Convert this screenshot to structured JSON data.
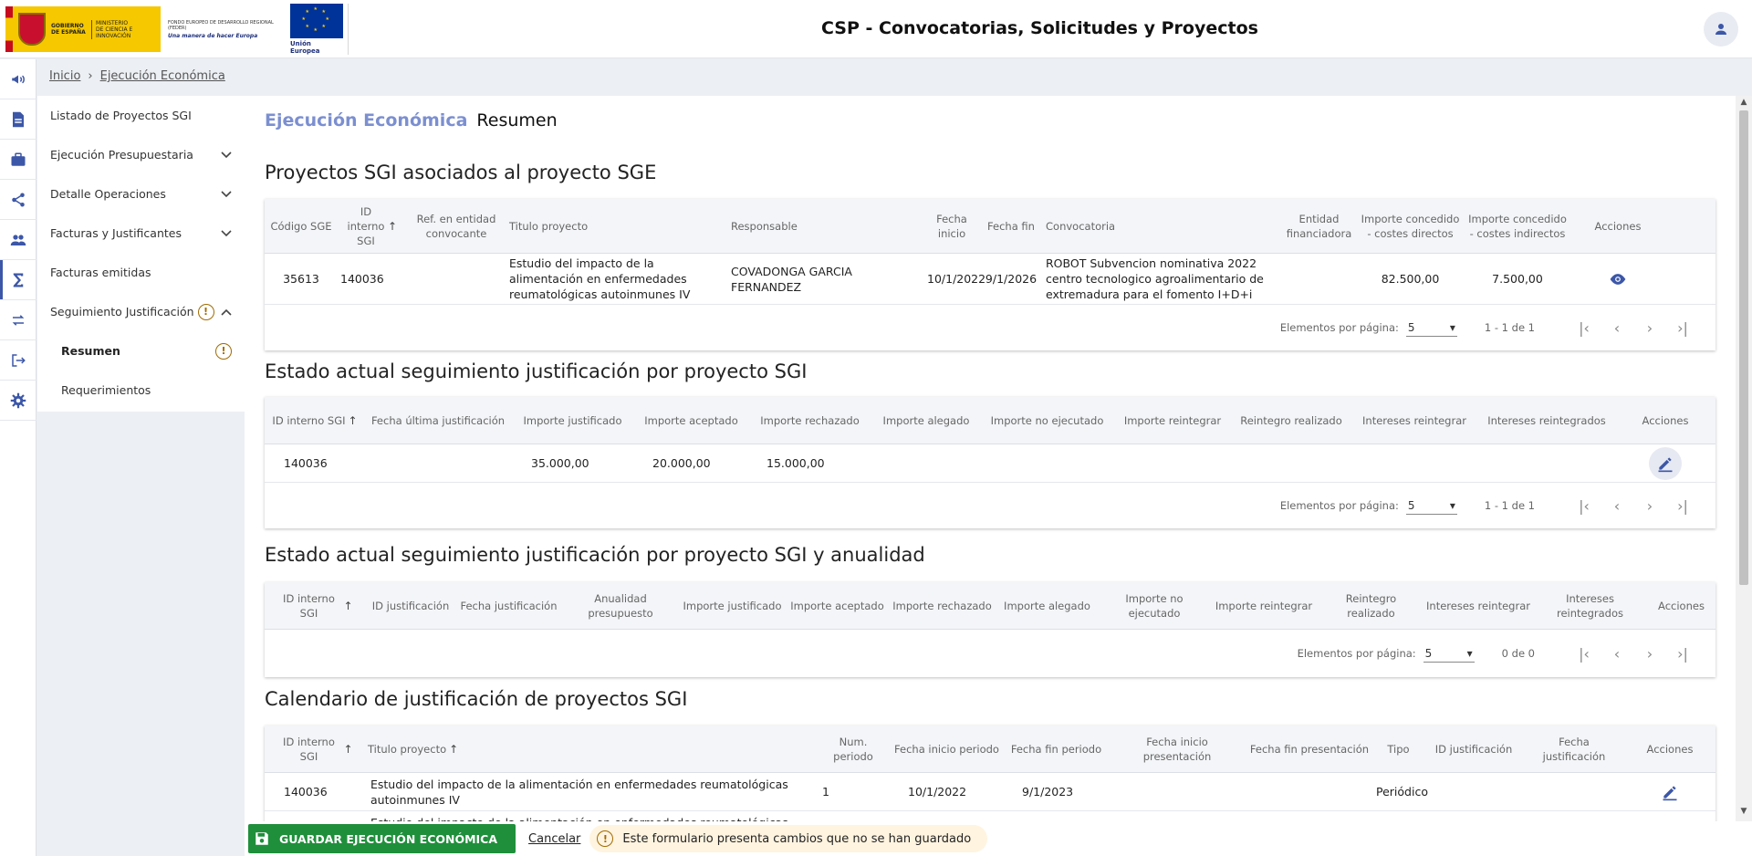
{
  "header": {
    "gov_text": "GOBIERNO DE ESPAÑA",
    "ministry_text": "MINISTERIO DE CIENCIA E INNOVACIÓN",
    "feder_text": "FONDO EUROPEO DE DESARROLLO REGIONAL (FEDER)",
    "feder_slogan": "Una manera de hacer Europa",
    "eu_text": "Unión Europea",
    "title": "CSP - Convocatorias, Solicitudes y Proyectos"
  },
  "rail": [
    "megaphone-icon",
    "document-icon",
    "briefcase-icon",
    "share-icon",
    "people-icon",
    "sigma-icon",
    "swap-icon",
    "logout-icon",
    "settings-icon"
  ],
  "breadcrumb": {
    "home": "Inicio",
    "current": "Ejecución Económica"
  },
  "menu": {
    "listado": "Listado de Proyectos SGI",
    "ejecucion_presupuestaria": "Ejecución Presupuestaria",
    "detalle_operaciones": "Detalle Operaciones",
    "facturas_justificantes": "Facturas y Justificantes",
    "facturas_emitidas": "Facturas emitidas",
    "seguimiento": "Seguimiento Justificación",
    "resumen": "Resumen",
    "requerimientos": "Requerimientos",
    "warn_glyph": "!"
  },
  "page": {
    "title": "Ejecución Económica",
    "subtitle": "Resumen"
  },
  "section1": {
    "title": "Proyectos SGI asociados al proyecto SGE",
    "headers": {
      "codigo": "Código SGE",
      "id_interno": "ID interno SGI",
      "ref": "Ref. en entidad convocante",
      "titulo": "Titulo proyecto",
      "responsable": "Responsable",
      "fecha_inicio": "Fecha inicio",
      "fecha_fin": "Fecha fin",
      "convocatoria": "Convocatoria",
      "entidad": "Entidad financiadora",
      "imp_directos": "Importe concedido - costes directos",
      "imp_indirectos": "Importe concedido - costes indirectos",
      "acciones": "Acciones"
    },
    "row": {
      "codigo": "35613",
      "id_interno": "140036",
      "titulo": "Estudio del impacto de la alimentación en enfermedades reumatológicas autoinmunes IV",
      "responsable": "COVADONGA GARCIA FERNANDEZ",
      "fecha_inicio": "10/1/2022",
      "fecha_fin": "9/1/2026",
      "convocatoria": "ROBOT Subvencion nominativa 2022 centro tecnologico agroalimentario de extremadura para el fomento I+D+i",
      "imp_directos": "82.500,00",
      "imp_indirectos": "7.500,00"
    },
    "paginator": {
      "label": "Elementos por página:",
      "size": "5",
      "range": "1 - 1 de 1"
    }
  },
  "section2": {
    "title": "Estado actual seguimiento justificación por proyecto SGI",
    "headers": {
      "id_interno": "ID interno SGI",
      "fecha_ultima": "Fecha última justificación",
      "imp_justificado": "Importe justificado",
      "imp_aceptado": "Importe aceptado",
      "imp_rechazado": "Importe rechazado",
      "imp_alegado": "Importe alegado",
      "imp_no_ejecutado": "Importe no ejecutado",
      "imp_reintegrar": "Importe reintegrar",
      "reintegro_realizado": "Reintegro realizado",
      "intereses_reintegrar": "Intereses reintegrar",
      "intereses_reintegrados": "Intereses reintegrados",
      "acciones": "Acciones"
    },
    "row": {
      "id_interno": "140036",
      "imp_justificado": "35.000,00",
      "imp_aceptado": "20.000,00",
      "imp_rechazado": "15.000,00"
    },
    "paginator": {
      "label": "Elementos por página:",
      "size": "5",
      "range": "1 - 1 de 1"
    }
  },
  "section3": {
    "title": "Estado actual seguimiento justificación por proyecto SGI y anualidad",
    "headers": {
      "id_interno": "ID interno SGI",
      "id_justificacion": "ID justificación",
      "fecha_justificacion": "Fecha justificación",
      "anualidad": "Anualidad presupuesto",
      "imp_justificado": "Importe justificado",
      "imp_aceptado": "Importe aceptado",
      "imp_rechazado": "Importe rechazado",
      "imp_alegado": "Importe alegado",
      "imp_no_ejecutado": "Importe no ejecutado",
      "imp_reintegrar": "Importe reintegrar",
      "reintegro_realizado": "Reintegro realizado",
      "intereses_reintegrar": "Intereses reintegrar",
      "intereses_reintegrados": "Intereses reintegrados",
      "acciones": "Acciones"
    },
    "paginator": {
      "label": "Elementos por página:",
      "size": "5",
      "range": "0 de 0"
    }
  },
  "section4": {
    "title": "Calendario de justificación de proyectos SGI",
    "headers": {
      "id_interno": "ID interno SGI",
      "titulo": "Titulo proyecto",
      "num_periodo": "Num. periodo",
      "fecha_inicio_periodo": "Fecha inicio periodo",
      "fecha_fin_periodo": "Fecha fin periodo",
      "fecha_inicio_pres": "Fecha inicio presentación",
      "fecha_fin_pres": "Fecha fin presentación",
      "tipo": "Tipo",
      "id_justificacion": "ID justificación",
      "fecha_justificacion": "Fecha justificación",
      "acciones": "Acciones"
    },
    "row": {
      "id_interno": "140036",
      "titulo": "Estudio del impacto de la alimentación en enfermedades reumatológicas autoinmunes IV",
      "num_periodo": "1",
      "fecha_inicio_periodo": "10/1/2022",
      "fecha_fin_periodo": "9/1/2023",
      "tipo": "Periódico"
    },
    "row2_titulo": "Estudio del impacto de la alimentación en enfermedades reumatológicas"
  },
  "bottom": {
    "save": "GUARDAR EJECUCIÓN ECONÓMICA",
    "cancel": "Cancelar",
    "unsaved": "Este formulario presenta cambios que no se han guardado"
  },
  "colors": {
    "accent": "#3c57a8",
    "save_green": "#1f8f3b",
    "warning": "#a16b00"
  }
}
